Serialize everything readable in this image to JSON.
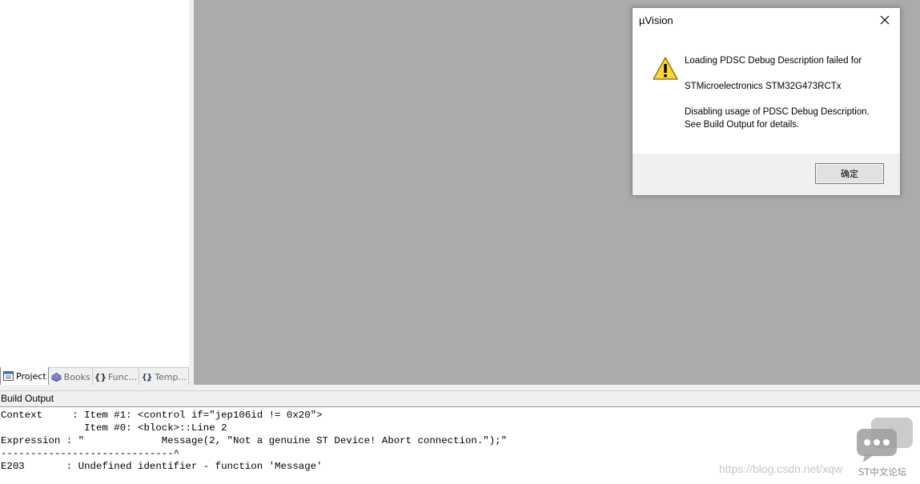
{
  "project_panel": {
    "tabs": [
      {
        "label": "Project",
        "icon": "project-icon",
        "active": true
      },
      {
        "label": "Books",
        "icon": "books-icon",
        "active": false
      },
      {
        "label": "Func...",
        "icon": "functions-icon",
        "active": false
      },
      {
        "label": "Temp...",
        "icon": "templates-icon",
        "active": false
      }
    ]
  },
  "build_output": {
    "title": "Build Output",
    "text": "Context     : Item #1: <control if=\"jep106id != 0x20\">\n              Item #0: <block>::Line 2\nExpression : \"             Message(2, \"Not a genuine ST Device! Abort connection.\");\"\n-----------------------------^\nE203       : Undefined identifier - function 'Message'"
  },
  "dialog": {
    "title": "µVision",
    "icon": "warning-icon",
    "message_line1": "Loading PDSC Debug Description failed for",
    "message_line2": "STMicroelectronics STM32G473RCTx",
    "message_line3": "Disabling usage of PDSC Debug Description.",
    "message_line4": "See Build Output for details.",
    "ok_label": "确定"
  },
  "watermark": {
    "url": "https://blog.csdn.net/xqw",
    "brand": "ST中文论坛"
  },
  "colors": {
    "editor_background": "#ababab",
    "panel_background": "#f0f0f0"
  }
}
